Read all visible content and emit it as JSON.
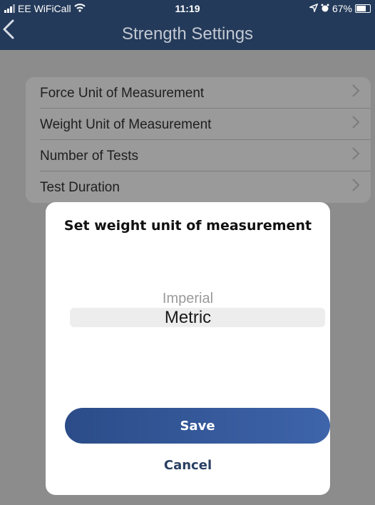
{
  "status_bar": {
    "carrier": "EE WiFiCall",
    "time": "11:19",
    "battery": "67%",
    "icons": [
      "signal-icon",
      "wifi-icon",
      "location-icon",
      "alarm-icon",
      "battery-icon"
    ]
  },
  "navbar": {
    "title": "Strength Settings",
    "back_icon": "chevron-left-icon"
  },
  "settings_list": {
    "items": [
      {
        "label": "Force Unit of Measurement"
      },
      {
        "label": "Weight Unit of Measurement"
      },
      {
        "label": "Number of Tests"
      },
      {
        "label": "Test Duration"
      }
    ]
  },
  "dialog": {
    "title": "Set weight unit of measurement",
    "picker": {
      "options": [
        "Imperial",
        "Metric"
      ],
      "selected": "Metric"
    },
    "save_label": "Save",
    "cancel_label": "Cancel"
  },
  "colors": {
    "navbar": "#243a5a",
    "save_button": "#2e5293",
    "cancel_text": "#2a3f63"
  }
}
